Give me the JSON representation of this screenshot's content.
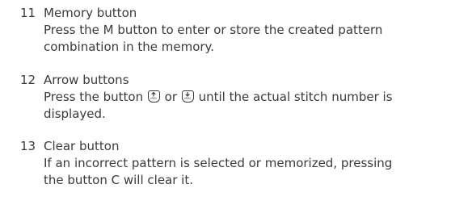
{
  "entries": [
    {
      "number": "11",
      "title": "Memory button",
      "lines": [
        "Press the M button to enter or store the created pattern",
        "combination in the memory."
      ]
    },
    {
      "number": "12",
      "title": "Arrow buttons",
      "line1_before": "Press the button",
      "line1_middle": "or",
      "line1_after": "until the actual stitch number is",
      "line2": "displayed.",
      "icons": [
        "mem-up-arrow-key-icon",
        "mem-down-arrow-key-icon"
      ],
      "icon_caption": "MEM"
    },
    {
      "number": "13",
      "title": "Clear button",
      "lines": [
        "If an incorrect pattern is selected or memorized, pressing",
        "the button C will clear it."
      ]
    }
  ]
}
